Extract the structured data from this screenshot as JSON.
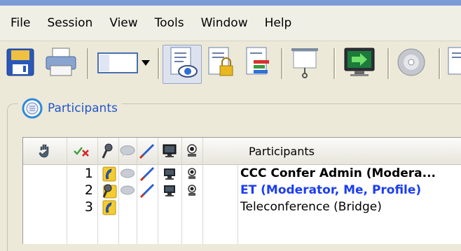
{
  "menu": {
    "items": [
      "File",
      "Session",
      "View",
      "Tools",
      "Window",
      "Help"
    ]
  },
  "toolbar": {
    "buttons": [
      "save-icon",
      "print-icon",
      "layout-icon",
      "view-participants-icon",
      "secure-document-icon",
      "chart-document-icon",
      "presentation-screen-icon",
      "share-screen-icon",
      "disc-icon",
      "document-icon"
    ]
  },
  "panel": {
    "title": "Participants"
  },
  "grid": {
    "header": {
      "participants_label": "Participants"
    },
    "rows": [
      {
        "number": "1",
        "name": "CCC Confer Admin (Modera..."
      },
      {
        "number": "2",
        "name": "ET (Moderator, Me, Profile)"
      },
      {
        "number": "3",
        "name": "Teleconference (Bridge)"
      }
    ]
  }
}
